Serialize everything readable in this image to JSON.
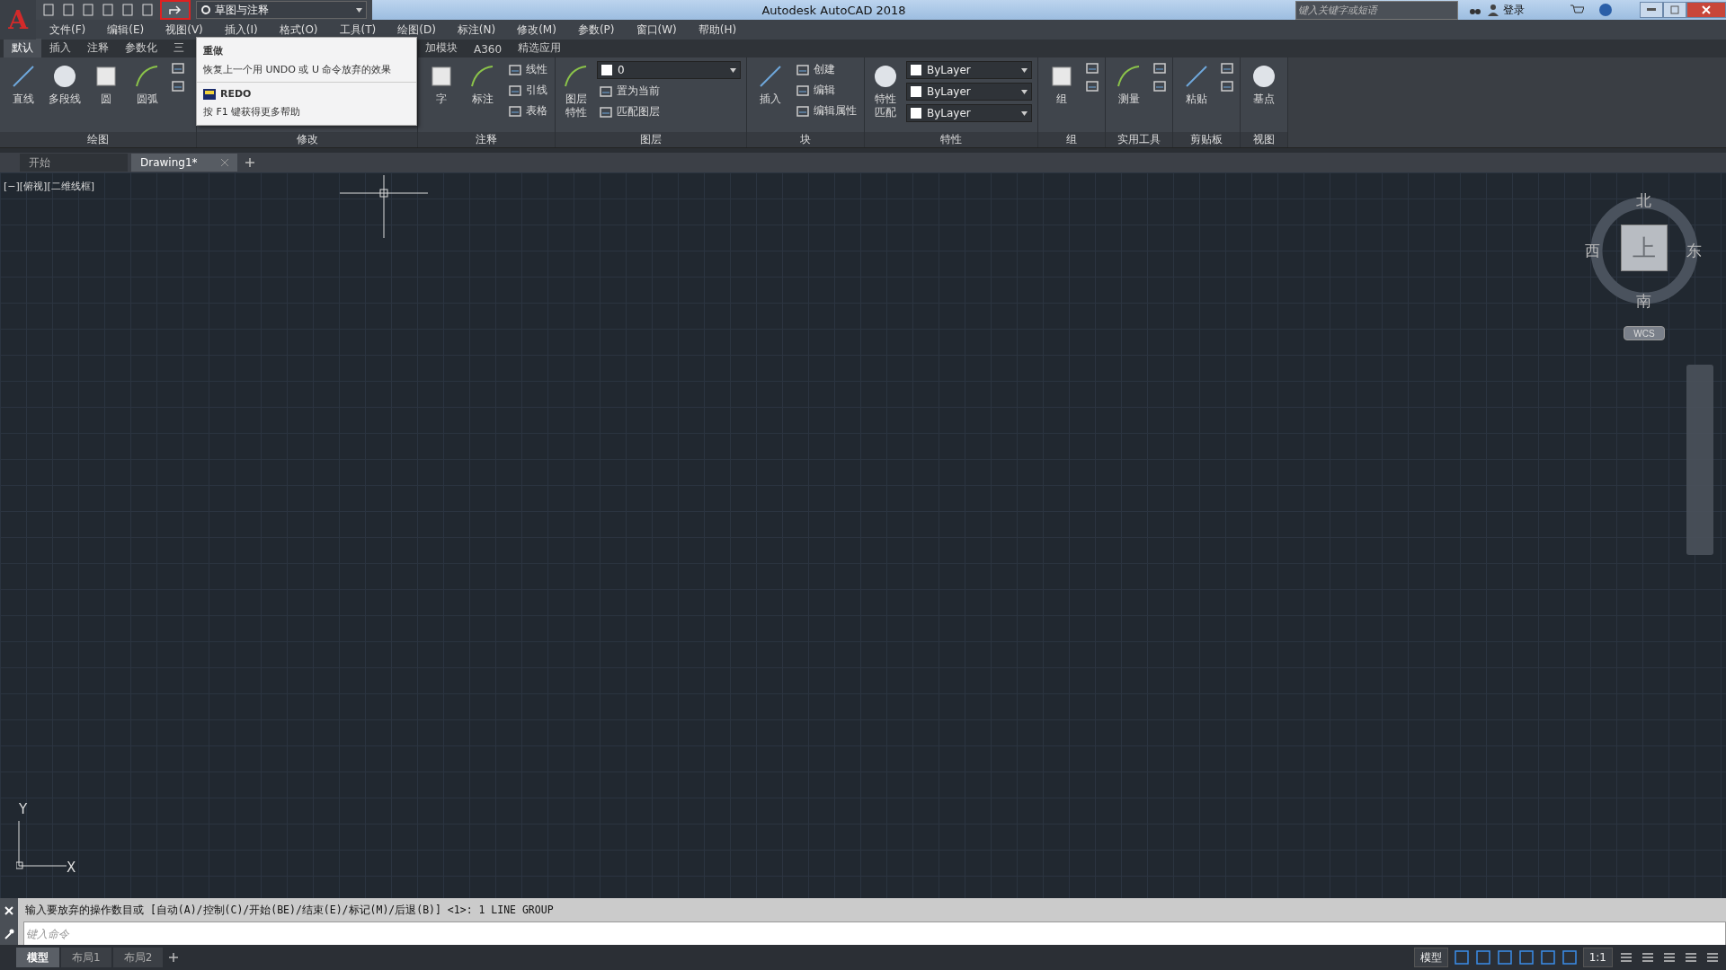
{
  "title_bar": {
    "logo": "A",
    "workspace": "草图与注释",
    "title": "Autodesk AutoCAD 2018",
    "search": {
      "placeholder": "键入关键字或短语"
    },
    "sign_in": "登录"
  },
  "menu_bar": [
    "文件(F)",
    "编辑(E)",
    "视图(V)",
    "插入(I)",
    "格式(O)",
    "工具(T)",
    "绘图(D)",
    "标注(N)",
    "修改(M)",
    "参数(P)",
    "窗口(W)",
    "帮助(H)"
  ],
  "ribbon_tabs": [
    {
      "label": "默认",
      "selected": true
    },
    {
      "label": "插入",
      "selected": false
    },
    {
      "label": "注释",
      "selected": false
    },
    {
      "label": "参数化",
      "selected": false
    },
    {
      "label": "三",
      "selected": false
    },
    {
      "label": "加模块",
      "selected": false
    },
    {
      "label": "A360",
      "selected": false
    },
    {
      "label": "精选应用",
      "selected": false
    }
  ],
  "ribbon_panels": [
    {
      "title": "绘图",
      "tools": [
        {
          "kind": "large",
          "label": "直线"
        },
        {
          "kind": "large",
          "label": "多段线"
        },
        {
          "kind": "large",
          "label": "圆"
        },
        {
          "kind": "large",
          "label": "圆弧"
        },
        {
          "kind": "icons"
        }
      ]
    },
    {
      "title": "修改"
    },
    {
      "title": "注释",
      "tools": [
        {
          "kind": "large",
          "label": "字"
        },
        {
          "kind": "large",
          "label": "标注"
        },
        {
          "kind": "small",
          "label": "线性"
        },
        {
          "kind": "small",
          "label": "引线"
        },
        {
          "kind": "small",
          "label": "表格"
        }
      ]
    },
    {
      "title": "图层",
      "tools": [
        {
          "kind": "large",
          "label": "图层特性"
        },
        {
          "kind": "dropdown",
          "label": "0"
        },
        {
          "kind": "small",
          "label": "置为当前"
        },
        {
          "kind": "small",
          "label": "匹配图层"
        }
      ]
    },
    {
      "title": "块",
      "tools": [
        {
          "kind": "large",
          "label": "插入"
        },
        {
          "kind": "small",
          "label": "创建"
        },
        {
          "kind": "small",
          "label": "编辑"
        },
        {
          "kind": "small",
          "label": "编辑属性"
        }
      ]
    },
    {
      "title": "特性",
      "tools": [
        {
          "kind": "large",
          "label": "特性匹配"
        },
        {
          "kind": "dropdown",
          "label": "ByLayer"
        },
        {
          "kind": "dropdown",
          "label": "ByLayer"
        },
        {
          "kind": "dropdown",
          "label": "ByLayer"
        }
      ]
    },
    {
      "title": "组",
      "tools": [
        {
          "kind": "large",
          "label": "组"
        },
        {
          "kind": "icons"
        }
      ]
    },
    {
      "title": "实用工具",
      "tools": [
        {
          "kind": "large",
          "label": "测量"
        },
        {
          "kind": "icons"
        }
      ]
    },
    {
      "title": "剪贴板",
      "tools": [
        {
          "kind": "large",
          "label": "粘贴"
        },
        {
          "kind": "icons"
        }
      ]
    },
    {
      "title": "视图",
      "tools": [
        {
          "kind": "large",
          "label": "基点"
        }
      ]
    }
  ],
  "tooltip": {
    "title": "重做",
    "description": "恢复上一个用 UNDO 或 U 命令放弃的效果",
    "command": "REDO",
    "help": "按 F1 键获得更多帮助"
  },
  "document_tabs": [
    {
      "label": "开始",
      "selected": false
    },
    {
      "label": "Drawing1*",
      "selected": true
    }
  ],
  "viewport": {
    "label": "[−][俯视][二维线框]",
    "compass": {
      "north": "北",
      "south": "南",
      "east": "东",
      "west": "西",
      "top": "上"
    },
    "ucs": "WCS",
    "axes": {
      "x": "X",
      "y": "Y"
    }
  },
  "command_line": {
    "history": "输入要放弃的操作数目或 [自动(A)/控制(C)/开始(BE)/结束(E)/标记(M)/后退(B)] <1>: 1 LINE GROUP",
    "placeholder": "键入命令"
  },
  "layout_tabs": [
    {
      "label": "模型",
      "selected": true
    },
    {
      "label": "布局1",
      "selected": false
    },
    {
      "label": "布局2",
      "selected": false
    }
  ],
  "status_bar": {
    "model": "模型",
    "scale": "1:1"
  }
}
